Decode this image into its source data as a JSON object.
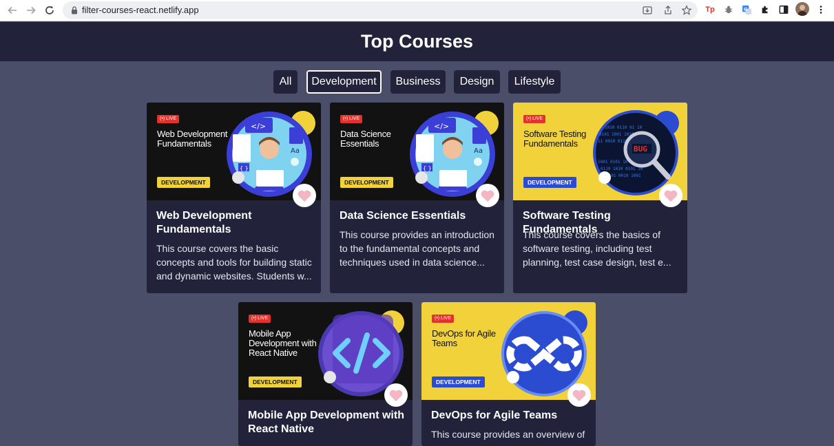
{
  "browser": {
    "url": "filter-courses-react.netlify.app",
    "ext_tp_label": "Tp"
  },
  "site": {
    "title": "Top Courses"
  },
  "filters": [
    {
      "label": "All",
      "active": false
    },
    {
      "label": "Development",
      "active": true
    },
    {
      "label": "Business",
      "active": false
    },
    {
      "label": "Design",
      "active": false
    },
    {
      "label": "Lifestyle",
      "active": false
    }
  ],
  "courses": [
    {
      "thumb_live": "(•) LIVE",
      "thumb_title": "Web Development Fundamentals",
      "thumb_category": "DEVELOPMENT",
      "title": "Web Development Fundamentals",
      "description": "This course covers the basic concepts and tools for building static and dynamic websites. Students w..."
    },
    {
      "thumb_live": "(•) LIVE",
      "thumb_title": "Data Science Essentials",
      "thumb_category": "DEVELOPMENT",
      "title": "Data Science Essentials",
      "description": "This course provides an introduction to the fundamental concepts and techniques used in data science..."
    },
    {
      "thumb_live": "(•) LIVE",
      "thumb_title": "Software Testing Fundamentals",
      "thumb_category": "DEVELOPMENT",
      "title": "Software Testing Fundamentals",
      "description": "This course covers the basics of software testing, including test planning, test case design, test e..."
    },
    {
      "thumb_live": "(•) LIVE",
      "thumb_title": "Mobile App Development with React Native",
      "thumb_category": "DEVELOPMENT",
      "title": "Mobile App Development with React Native",
      "description": ""
    },
    {
      "thumb_live": "(•) LIVE",
      "thumb_title": "DevOps for Agile Teams",
      "thumb_category": "DEVELOPMENT",
      "title": "DevOps for Agile Teams",
      "description": "This course provides an overview of"
    }
  ],
  "art_labels": {
    "code_tag": "</>",
    "aa": "Aa",
    "brackets": "{ }",
    "bug": "BUG"
  },
  "colors": {
    "header_bg": "#22223b",
    "page_bg": "#4a4e69",
    "card_bg": "#22223b",
    "thumb_yellow": "#f2d23a",
    "live_red": "#e3322b",
    "heart_pink": "#f4b6c2"
  },
  "icons": [
    "back-arrow-icon",
    "forward-arrow-icon",
    "reload-icon",
    "lock-icon",
    "install-icon",
    "share-icon",
    "star-icon",
    "extension-icon",
    "sidebar-icon",
    "menu-icon",
    "heart-icon"
  ]
}
